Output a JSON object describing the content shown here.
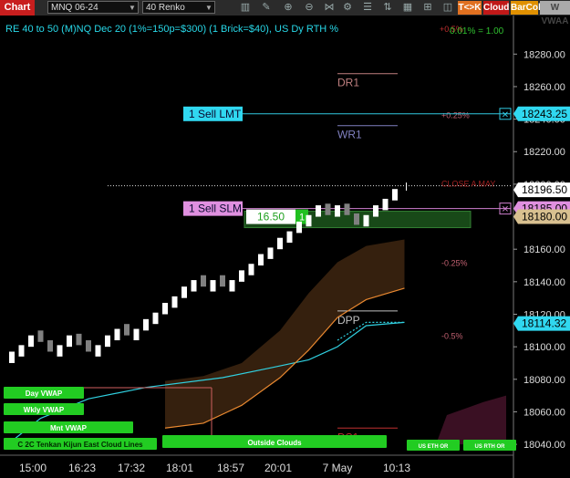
{
  "toolbar": {
    "window_title": "Chart",
    "instrument": "MNQ 06-24",
    "bar_type": "40 Renko",
    "badges": [
      "T<>K",
      "Cloud",
      "BarCol",
      "W VWAA"
    ]
  },
  "header": {
    "info": "RE 40 to 50 (M)NQ Dec 20 (1%=150p=$300) (1 Brick=$40), US Dy RTH %",
    "ratio": "0.01% = 1.00",
    "ratio_top": "+0.5%"
  },
  "chart_data": {
    "type": "renko",
    "ylim": [
      18035,
      18297
    ],
    "y_ticks": [
      "18280.00",
      "18260.00",
      "18240.00",
      "18220.00",
      "18200.00",
      "18180.00",
      "18160.00",
      "18140.00",
      "18120.00",
      "18100.00",
      "18080.00",
      "18060.00",
      "18040.00"
    ],
    "x_ticks": [
      "15:00",
      "16:23",
      "17:32",
      "18:01",
      "18:57",
      "20:01",
      "7 May",
      "10:13"
    ],
    "bricks": [
      {
        "close": 18097,
        "dir": "up"
      },
      {
        "close": 18101,
        "dir": "up"
      },
      {
        "close": 18107,
        "dir": "up"
      },
      {
        "close": 18103,
        "dir": "down"
      },
      {
        "close": 18097,
        "dir": "down"
      },
      {
        "close": 18101,
        "dir": "up"
      },
      {
        "close": 18107,
        "dir": "up"
      },
      {
        "close": 18101,
        "dir": "down"
      },
      {
        "close": 18097,
        "dir": "down"
      },
      {
        "close": 18101,
        "dir": "up"
      },
      {
        "close": 18107,
        "dir": "up"
      },
      {
        "close": 18111,
        "dir": "up"
      },
      {
        "close": 18107,
        "dir": "down"
      },
      {
        "close": 18111,
        "dir": "up"
      },
      {
        "close": 18117,
        "dir": "up"
      },
      {
        "close": 18121,
        "dir": "up"
      },
      {
        "close": 18127,
        "dir": "up"
      },
      {
        "close": 18131,
        "dir": "up"
      },
      {
        "close": 18137,
        "dir": "up"
      },
      {
        "close": 18141,
        "dir": "up"
      },
      {
        "close": 18137,
        "dir": "down"
      },
      {
        "close": 18141,
        "dir": "up"
      },
      {
        "close": 18137,
        "dir": "down"
      },
      {
        "close": 18141,
        "dir": "up"
      },
      {
        "close": 18147,
        "dir": "up"
      },
      {
        "close": 18151,
        "dir": "up"
      },
      {
        "close": 18157,
        "dir": "up"
      },
      {
        "close": 18161,
        "dir": "up"
      },
      {
        "close": 18167,
        "dir": "up"
      },
      {
        "close": 18171,
        "dir": "up"
      },
      {
        "close": 18177,
        "dir": "up"
      },
      {
        "close": 18181,
        "dir": "up"
      },
      {
        "close": 18187,
        "dir": "up"
      },
      {
        "close": 18181,
        "dir": "down"
      },
      {
        "close": 18187,
        "dir": "up"
      },
      {
        "close": 18181,
        "dir": "down"
      },
      {
        "close": 18175,
        "dir": "down"
      },
      {
        "close": 18181,
        "dir": "up"
      },
      {
        "close": 18187,
        "dir": "up"
      },
      {
        "close": 18191,
        "dir": "up"
      },
      {
        "close": 18197,
        "dir": "up"
      }
    ],
    "vwap_line": [
      [
        0,
        18042
      ],
      [
        3,
        18056
      ],
      [
        8,
        18068
      ],
      [
        14,
        18075
      ],
      [
        22,
        18081
      ],
      [
        27,
        18087
      ],
      [
        31,
        18092
      ],
      [
        34,
        18100
      ],
      [
        37,
        18113
      ],
      [
        41,
        18115
      ]
    ],
    "dpp_line": [
      [
        16,
        18050
      ],
      [
        20,
        18053
      ],
      [
        24,
        18064
      ],
      [
        28,
        18081
      ],
      [
        31,
        18098
      ],
      [
        34,
        18118
      ],
      [
        37,
        18129
      ],
      [
        41,
        18136
      ]
    ],
    "cloud_upper": [
      [
        16,
        18079
      ],
      [
        20,
        18082
      ],
      [
        24,
        18090
      ],
      [
        28,
        18110
      ],
      [
        31,
        18133
      ],
      [
        34,
        18152
      ],
      [
        37,
        18162
      ],
      [
        41,
        18166
      ]
    ],
    "cloud_lower": [
      [
        16,
        18050
      ],
      [
        20,
        18053
      ],
      [
        24,
        18064
      ],
      [
        28,
        18081
      ],
      [
        31,
        18098
      ],
      [
        34,
        18118
      ],
      [
        37,
        18129
      ],
      [
        41,
        18136
      ]
    ],
    "levels": [
      {
        "name": "DR1",
        "price": 18268
      },
      {
        "name": "WR1",
        "price": 18236
      },
      {
        "name": "CLOSE A MAY",
        "price": 18199
      },
      {
        "name": "DPP",
        "price": 18122
      },
      {
        "name": "DS1",
        "price": 18050
      }
    ],
    "percent_labels": [
      {
        "label": "+0.25%",
        "price": 18243
      },
      {
        "label": "-0.25%",
        "price": 18152
      },
      {
        "label": "-0.5%",
        "price": 18107
      }
    ],
    "price_tags": [
      {
        "price": "18243.25",
        "value": 18243.25,
        "kind": "order"
      },
      {
        "price": "18196.50",
        "value": 18196.5,
        "kind": "last"
      },
      {
        "price": "18185.00",
        "value": 18185,
        "kind": "order2"
      },
      {
        "price": "18180.00",
        "value": 18180,
        "kind": "pos"
      },
      {
        "price": "18114.32",
        "value": 18114.32,
        "kind": "vwap"
      }
    ],
    "orders": [
      {
        "label": "1 Sell LMT",
        "price": 18243.25
      },
      {
        "label": "1 Sell SLM",
        "price": 18185
      }
    ],
    "position": {
      "pnl": "16.50",
      "qty": "1",
      "price": 18180
    },
    "bottom_labels": [
      {
        "label": "Day VWAP"
      },
      {
        "label": "Wkly VWAP"
      },
      {
        "label": "Mnt VWAP"
      },
      {
        "label": "C 2C Tenkan Kijun East Cloud Lines"
      },
      {
        "label": "Outside Clouds"
      },
      {
        "label": "US ETH OR"
      },
      {
        "label": "US RTH OR"
      }
    ]
  }
}
